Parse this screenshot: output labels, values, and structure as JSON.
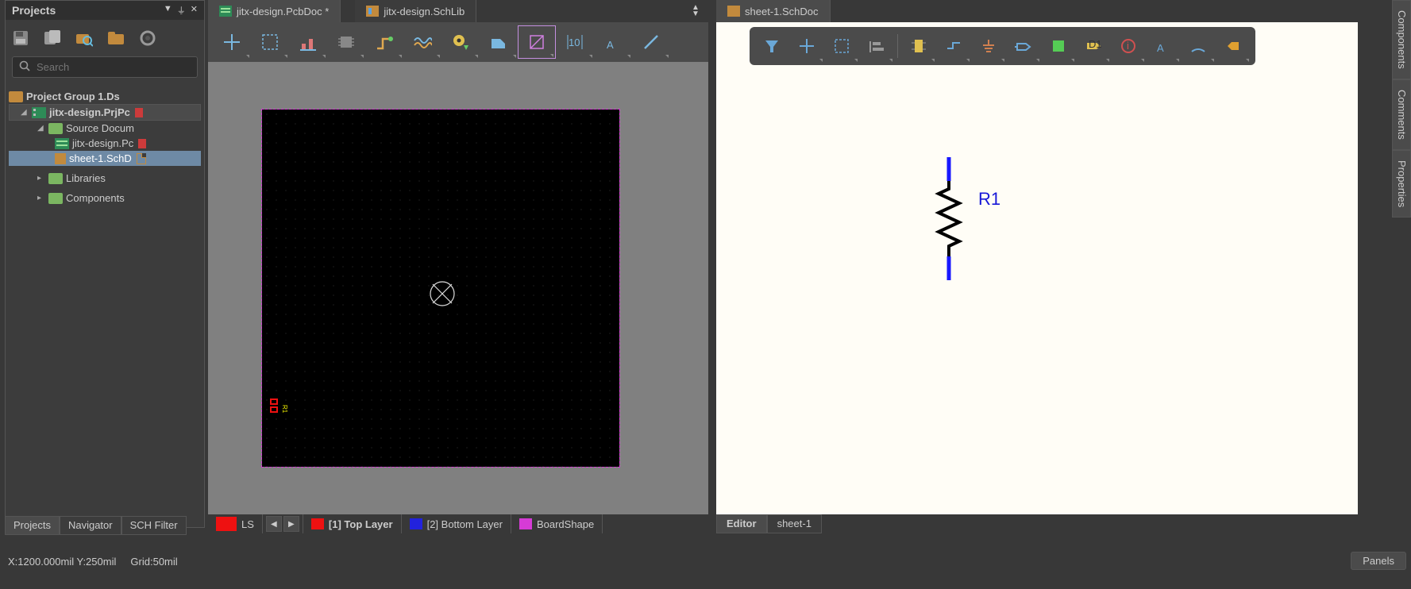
{
  "projects_panel": {
    "title": "Projects",
    "search_placeholder": "Search",
    "tree": {
      "group": "Project Group 1.Ds",
      "project": "jitx-design.PrjPc",
      "source_docs": "Source Docum",
      "pcb_doc": "jitx-design.Pc",
      "sch_doc": "sheet-1.SchD",
      "libraries": "Libraries",
      "components": "Components"
    },
    "bottom_tabs": [
      "Projects",
      "Navigator",
      "SCH Filter"
    ]
  },
  "doc_tabs": {
    "pcb": "jitx-design.PcbDoc *",
    "schlib": "jitx-design.SchLib",
    "sheet": "sheet-1.SchDoc"
  },
  "pcb_bottom": {
    "ls": "LS",
    "top_layer": "[1] Top Layer",
    "bottom_layer": "[2] Bottom Layer",
    "board_shape": "BoardShape"
  },
  "pcb_canvas": {
    "component_ref": "R1"
  },
  "sch_bottom": {
    "editor": "Editor",
    "sheet": "sheet-1"
  },
  "schematic": {
    "resistor_ref": "R1"
  },
  "status": {
    "coords": "X:1200.000mil Y:250mil",
    "grid": "Grid:50mil"
  },
  "side_tabs": [
    "Components",
    "Comments",
    "Properties"
  ],
  "panels_button": "Panels"
}
